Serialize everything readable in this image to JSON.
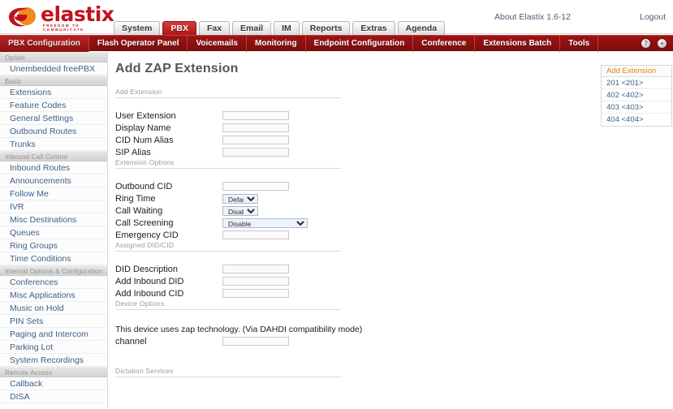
{
  "header": {
    "logo_text": "elastix",
    "logo_tagline": "FREEDOM TO COMMUNICATE",
    "about_label": "About Elastix 1.6-12",
    "logout_label": "Logout"
  },
  "tabs": [
    {
      "label": "System",
      "active": false
    },
    {
      "label": "PBX",
      "active": true
    },
    {
      "label": "Fax",
      "active": false
    },
    {
      "label": "Email",
      "active": false
    },
    {
      "label": "IM",
      "active": false
    },
    {
      "label": "Reports",
      "active": false
    },
    {
      "label": "Extras",
      "active": false
    },
    {
      "label": "Agenda",
      "active": false
    }
  ],
  "subnav": {
    "items": [
      {
        "label": "PBX Configuration",
        "active": true
      },
      {
        "label": "Flash Operator Panel",
        "active": false
      },
      {
        "label": "Voicemails",
        "active": false
      },
      {
        "label": "Monitoring",
        "active": false
      },
      {
        "label": "Endpoint Configuration",
        "active": false
      },
      {
        "label": "Conference",
        "active": false
      },
      {
        "label": "Extensions Batch",
        "active": false
      },
      {
        "label": "Tools",
        "active": false
      }
    ],
    "icons": [
      {
        "name": "help-icon",
        "glyph": "?"
      },
      {
        "name": "info-icon",
        "glyph": "+"
      }
    ]
  },
  "sidebar": {
    "groups": [
      {
        "title": "Option",
        "items": [
          "Unembedded freePBX"
        ]
      },
      {
        "title": "Basic",
        "items": [
          "Extensions",
          "Feature Codes",
          "General Settings",
          "Outbound Routes",
          "Trunks"
        ]
      },
      {
        "title": "Inbound Call Control",
        "items": [
          "Inbound Routes",
          "Announcements",
          "Follow Me",
          "IVR",
          "Misc Destinations",
          "Queues",
          "Ring Groups",
          "Time Conditions"
        ]
      },
      {
        "title": "Internal Options & Configuration",
        "items": [
          "Conferences",
          "Misc Applications",
          "Music on Hold",
          "PIN Sets",
          "Paging and Intercom",
          "Parking Lot",
          "System Recordings"
        ]
      },
      {
        "title": "Remote Access",
        "items": [
          "Callback",
          "DISA"
        ]
      }
    ]
  },
  "main": {
    "page_title": "Add ZAP Extension",
    "sections": {
      "add_extension": "Add Extension",
      "extension_options": "Extension Options",
      "assigned_did_cid": "Assigned DID/CID",
      "device_options": "Device Options",
      "dictation_services": "Dictation Services"
    },
    "fields": {
      "user_extension": {
        "label": "User Extension",
        "value": "",
        "type": "text"
      },
      "display_name": {
        "label": "Display Name",
        "value": "",
        "type": "text"
      },
      "cid_num_alias": {
        "label": "CID Num Alias",
        "value": "",
        "type": "text"
      },
      "sip_alias": {
        "label": "SIP Alias",
        "value": "",
        "type": "text"
      },
      "outbound_cid": {
        "label": "Outbound CID",
        "value": "",
        "type": "text"
      },
      "ring_time": {
        "label": "Ring Time",
        "value": "Default",
        "type": "select"
      },
      "call_waiting": {
        "label": "Call Waiting",
        "value": "Disable",
        "type": "select"
      },
      "call_screening": {
        "label": "Call Screening",
        "value": "Disable",
        "type": "select"
      },
      "emergency_cid": {
        "label": "Emergency CID",
        "value": "",
        "type": "text"
      },
      "did_description": {
        "label": "DID Description",
        "value": "",
        "type": "text"
      },
      "add_inbound_did": {
        "label": "Add Inbound DID",
        "value": "",
        "type": "text"
      },
      "add_inbound_cid": {
        "label": "Add Inbound CID",
        "value": "",
        "type": "text"
      },
      "channel": {
        "label": "channel",
        "value": "",
        "type": "text"
      }
    },
    "device_note": "This device uses zap technology. (Via DAHDI compatibility mode)"
  },
  "extension_panel": {
    "add_label": "Add Extension",
    "items": [
      "201 <201>",
      "402 <402>",
      "403 <403>",
      "404 <404>"
    ]
  },
  "colors": {
    "brand_red": "#c1121c",
    "nav_red": "#8e1111",
    "accent_orange": "#e8820c",
    "link_blue": "#3d6089"
  }
}
